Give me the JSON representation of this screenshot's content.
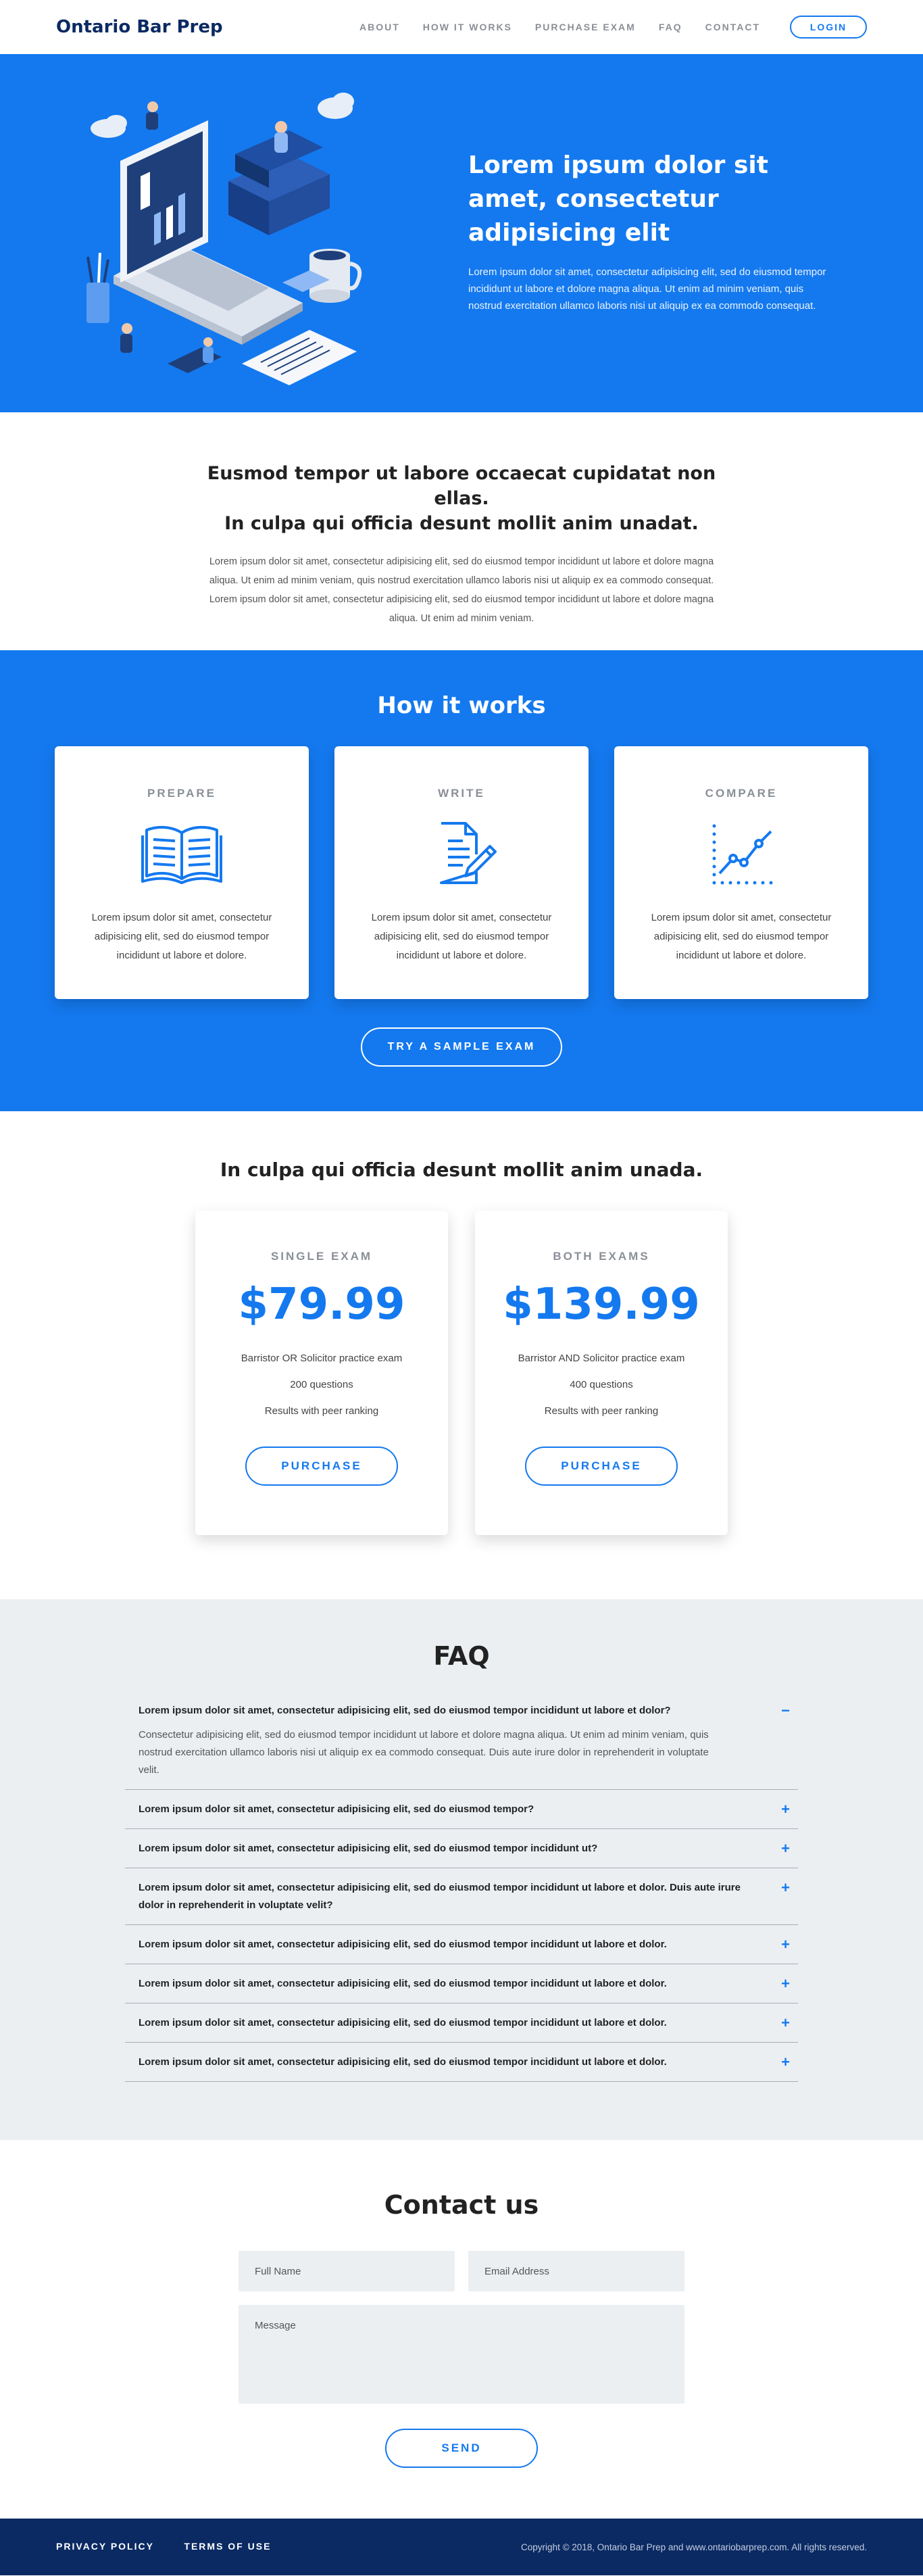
{
  "colors": {
    "accent": "#1479ef",
    "navy": "#0b2a63",
    "faq_bg": "#eceff2"
  },
  "nav": {
    "brand": "Ontario Bar Prep",
    "links": [
      "ABOUT",
      "HOW IT WORKS",
      "PURCHASE EXAM",
      "FAQ",
      "CONTACT"
    ],
    "login": "LOGIN"
  },
  "hero": {
    "title": "Lorem ipsum dolor sit amet, consectetur adipisicing elit",
    "description": "Lorem ipsum dolor sit amet, consectetur adipisicing elit, sed do eiusmod tempor incididunt ut labore et dolore magna aliqua. Ut enim ad minim veniam, quis nostrud exercitation ullamco laboris nisi ut aliquip ex ea commodo consequat."
  },
  "intro": {
    "title_line1": "Eusmod tempor ut labore occaecat cupidatat non ellas.",
    "title_line2": "In culpa qui officia desunt mollit anim unadat.",
    "description": "Lorem ipsum dolor sit amet, consectetur adipisicing elit, sed do eiusmod tempor incididunt ut labore et dolore magna aliqua. Ut enim ad minim veniam, quis nostrud exercitation ullamco laboris nisi ut aliquip ex ea commodo consequat. Lorem ipsum dolor sit amet, consectetur adipisicing elit, sed do eiusmod tempor incididunt ut labore et dolore magna aliqua. Ut enim ad minim veniam."
  },
  "how": {
    "title": "How it works",
    "cards": [
      {
        "title": "PREPARE",
        "icon": "open-book-icon",
        "description": "Lorem ipsum dolor sit amet, consectetur adipisicing elit, sed do eiusmod tempor incididunt ut labore et dolore."
      },
      {
        "title": "WRITE",
        "icon": "document-pen-icon",
        "description": "Lorem ipsum dolor sit amet, consectetur adipisicing elit, sed do eiusmod tempor incididunt ut labore et dolore."
      },
      {
        "title": "COMPARE",
        "icon": "line-chart-icon",
        "description": "Lorem ipsum dolor sit amet, consectetur adipisicing elit, sed do eiusmod tempor incididunt ut labore et dolore."
      }
    ],
    "button": "TRY A SAMPLE EXAM"
  },
  "pricing": {
    "title": "In culpa qui officia desunt mollit anim unada.",
    "plans": [
      {
        "label": "SINGLE EXAM",
        "price": "$79.99",
        "features": [
          "Barristor OR Solicitor practice exam",
          "200 questions",
          "Results with peer ranking"
        ],
        "button": "PURCHASE"
      },
      {
        "label": "BOTH EXAMS",
        "price": "$139.99",
        "features": [
          "Barristor AND Solicitor practice exam",
          "400 questions",
          "Results with peer ranking"
        ],
        "button": "PURCHASE"
      }
    ]
  },
  "faq": {
    "title": "FAQ",
    "items": [
      {
        "q": "Lorem ipsum dolor sit amet, consectetur adipisicing elit, sed do eiusmod tempor incididunt ut labore et dolor?",
        "a": "Consectetur adipisicing elit, sed do eiusmod tempor incididunt ut labore et dolore magna aliqua. Ut enim ad minim veniam, quis nostrud exercitation ullamco laboris nisi ut aliquip ex ea commodo consequat. Duis aute irure dolor in reprehenderit in voluptate velit.",
        "toggle": "−"
      },
      {
        "q": "Lorem ipsum dolor sit amet, consectetur adipisicing elit, sed do eiusmod tempor?",
        "a": "",
        "toggle": "+"
      },
      {
        "q": "Lorem ipsum dolor sit amet, consectetur adipisicing elit, sed do eiusmod tempor incididunt ut?",
        "a": "",
        "toggle": "+"
      },
      {
        "q": "Lorem ipsum dolor sit amet, consectetur adipisicing elit, sed do eiusmod tempor incididunt ut labore et dolor. Duis aute irure dolor in reprehenderit in voluptate velit?",
        "a": "",
        "toggle": "+"
      },
      {
        "q": "Lorem ipsum dolor sit amet, consectetur adipisicing elit, sed do eiusmod tempor incididunt ut labore et dolor.",
        "a": "",
        "toggle": "+"
      },
      {
        "q": "Lorem ipsum dolor sit amet, consectetur adipisicing elit, sed do eiusmod tempor incididunt ut labore et dolor.",
        "a": "",
        "toggle": "+"
      },
      {
        "q": "Lorem ipsum dolor sit amet, consectetur adipisicing elit, sed do eiusmod tempor incididunt ut labore et dolor.",
        "a": "",
        "toggle": "+"
      },
      {
        "q": "Lorem ipsum dolor sit amet, consectetur adipisicing elit, sed do eiusmod tempor incididunt ut labore et dolor.",
        "a": "",
        "toggle": "+"
      }
    ]
  },
  "contact": {
    "title": "Contact us",
    "name_placeholder": "Full Name",
    "email_placeholder": "Email Address",
    "message_placeholder": "Message",
    "button": "SEND"
  },
  "footer": {
    "links": [
      "PRIVACY POLICY",
      "TERMS OF USE"
    ],
    "copyright": "Copyright © 2018, Ontario Bar Prep and www.ontariobarprep.com. All rights reserved."
  }
}
